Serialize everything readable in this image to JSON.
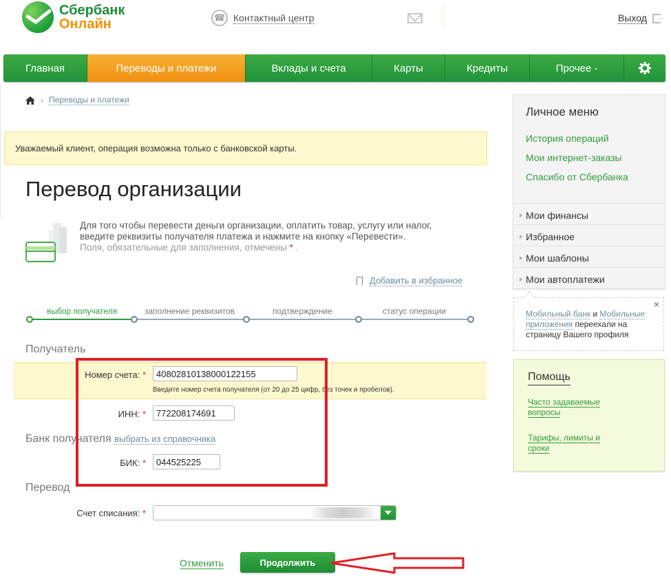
{
  "header": {
    "brand_line1": "Сбербанк",
    "brand_line2": "Онлайн",
    "contact_label": "Контактный центр",
    "logout_label": "Выход"
  },
  "nav": {
    "items": [
      "Главная",
      "Переводы и платежи",
      "Вклады и счета",
      "Карты",
      "Кредиты",
      "Прочее -"
    ],
    "active_index": 1
  },
  "breadcrumb": {
    "current": "Переводы и платежи"
  },
  "notice": "Уважаемый клиент, операция возможна только с банковской карты.",
  "page_title": "Перевод организации",
  "intro": {
    "text": "Для того чтобы перевести деньги организации, оплатить товар, услугу или налог, введите реквизиты получателя платежа и нажмите на кнопку «Перевести».",
    "hint_prefix": "Поля, обязательные для заполнения, отмечены",
    "required_mark": "*",
    "hint_suffix": "."
  },
  "favorite_label": "Добавить в избранное",
  "steps": [
    "выбор получателя",
    "заполнение реквизитов",
    "подтверждение",
    "статус операции"
  ],
  "sections": {
    "recipient": "Получатель",
    "bank": "Банк получателя",
    "bank_link": "выбрать из справочника",
    "transfer": "Перевод"
  },
  "fields": {
    "account_label": "Номер счета:",
    "account_value": "40802810138000122155",
    "account_hint": "Введите номер счета получателя (от 20 до 25 цифр, без точек и пробелов).",
    "inn_label": "ИНН:",
    "inn_value": "772208174691",
    "bik_label": "БИК:",
    "bik_value": "044525225",
    "debit_label": "Счет списания:",
    "required_mark": "*"
  },
  "actions": {
    "cancel": "Отменить",
    "continue": "Продолжить"
  },
  "sidebar": {
    "title": "Личное меню",
    "links": [
      "История операций",
      "Мои интернет-заказы",
      "Спасибо от Сбербанка"
    ],
    "rows": [
      "Мои финансы",
      "Избранное",
      "Мои шаблоны",
      "Мои автоплатежи"
    ]
  },
  "moved_notice": {
    "link1": "Мобильный банк",
    "and": "и",
    "link2": "Мобильные приложения",
    "rest": "переехали на страницу Вашего профиля",
    "close": "×"
  },
  "help": {
    "title": "Помощь",
    "links": [
      "Часто задаваемые вопросы",
      "Тарифы, лимиты и сроки"
    ]
  },
  "colors": {
    "brand_green": "#21923a",
    "brand_orange": "#f08f12",
    "annotation_red": "#e01e24"
  }
}
